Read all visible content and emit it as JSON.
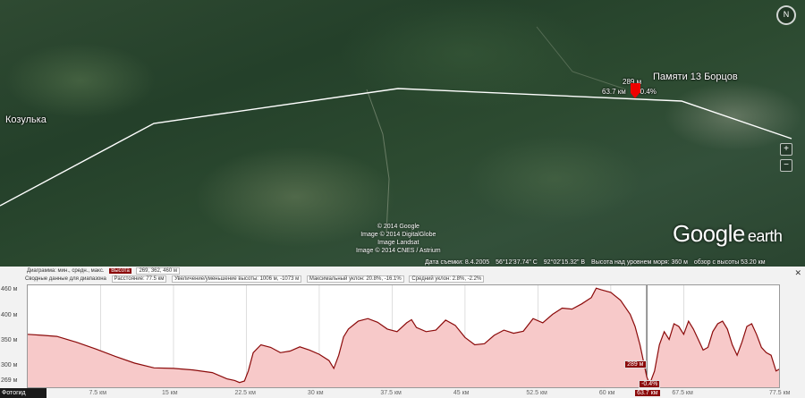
{
  "map": {
    "places": [
      {
        "id": "kozulka",
        "label": "Козулька"
      },
      {
        "id": "pamyati",
        "label": "Памяти 13 Борцов"
      }
    ],
    "marker": {
      "elevation": "289 м",
      "distance": "63.7 км",
      "slope": "-0.4%"
    },
    "credits": [
      "© 2014 Google",
      "Image © 2014 DigitalGlobe",
      "Image Landsat",
      "Image © 2014 CNES / Astrium"
    ],
    "logo": {
      "main": "Google",
      "sub": "earth"
    },
    "compass_label": "N",
    "zoom_in": "+",
    "zoom_out": "−",
    "status": {
      "date": "Дата съемки: 8.4.2005",
      "lat": "56°12'37.74\" С",
      "lon": "92°02'15.32\" В",
      "elev": "Высота над уровнем моря:   360 м",
      "eye": "обзор с высоты  53.20 км"
    },
    "colors": {
      "route": "#ffffff",
      "marker": "#ee0000"
    }
  },
  "panel": {
    "close": "✕",
    "row1": {
      "label": "Диаграмма: мин., средн., макс.",
      "key": "Высота",
      "value": "269, 362, 460 м"
    },
    "row2": {
      "summary": "Сводные данные для диапазона",
      "distance": "Расстояние: 77.5 км",
      "gain": "Увеличение/уменьшение высоты: 1006 м, -1073 м",
      "maxslope": "Максимальный уклон: 20.8%, -16.1%",
      "avgslope": "Средний уклон: 2.8%, -2.2%"
    },
    "marker_elev": "289 м",
    "marker_slope": "-0.4%",
    "photo_button": "Фотогид"
  },
  "chart_data": {
    "type": "area",
    "y_ticks": [
      "460 м",
      "400 м",
      "350 м",
      "300 м",
      "269 м"
    ],
    "ylim": [
      269,
      460
    ],
    "x_ticks": [
      "7.5 км",
      "15 км",
      "22.5 км",
      "30 км",
      "37.5 км",
      "45 км",
      "52.5 км",
      "60 км",
      "63.7 км",
      "67.5 км",
      "77.5 км"
    ],
    "x_tick_values": [
      7.5,
      15,
      22.5,
      30,
      37.5,
      45,
      52.5,
      60,
      63.7,
      67.5,
      77.5
    ],
    "highlight_x": 63.7,
    "xlim": [
      0,
      77.5
    ],
    "x": [
      0,
      1.5,
      3,
      5,
      7,
      9,
      11,
      13,
      15,
      17,
      19,
      20.5,
      21.3,
      21.8,
      22.3,
      22.7,
      23.2,
      24,
      25,
      26,
      27,
      28,
      29,
      30,
      31,
      31.5,
      32,
      32.5,
      33,
      34,
      35,
      36,
      37,
      38,
      39,
      39.5,
      40,
      41,
      42,
      43,
      44,
      45,
      46,
      47,
      48,
      49,
      50,
      51,
      52,
      53,
      54,
      55,
      56,
      57,
      58,
      58.5,
      59,
      60,
      61,
      62,
      62.5,
      63,
      63.7,
      64,
      64.5,
      65,
      65.5,
      66,
      66.5,
      67,
      67.5,
      68,
      68.5,
      69,
      69.5,
      70,
      70.5,
      71,
      71.5,
      72,
      72.5,
      73,
      73.5,
      74,
      74.5,
      75,
      75.5,
      76,
      76.5,
      77,
      77.5
    ],
    "values": [
      370,
      368,
      366,
      355,
      342,
      328,
      315,
      306,
      305,
      302,
      297,
      285,
      282,
      278,
      281,
      300,
      335,
      350,
      345,
      335,
      338,
      346,
      340,
      332,
      320,
      305,
      330,
      365,
      380,
      395,
      400,
      393,
      380,
      375,
      392,
      398,
      383,
      375,
      378,
      397,
      387,
      364,
      350,
      352,
      368,
      378,
      372,
      376,
      400,
      392,
      408,
      420,
      418,
      428,
      440,
      458,
      455,
      450,
      435,
      408,
      385,
      350,
      289,
      275,
      300,
      350,
      375,
      360,
      390,
      385,
      370,
      395,
      380,
      360,
      340,
      345,
      375,
      390,
      395,
      380,
      350,
      330,
      355,
      385,
      390,
      370,
      345,
      335,
      330,
      300,
      305,
      300
    ]
  }
}
